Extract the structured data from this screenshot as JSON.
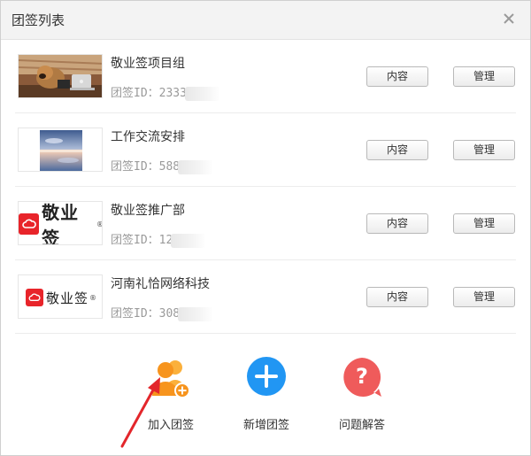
{
  "window": {
    "title": "团签列表",
    "close_icon": "close-icon"
  },
  "teams": [
    {
      "name": "敬业签项目组",
      "id_prefix": "团签ID：2333",
      "thumb": "dog-laptop-photo"
    },
    {
      "name": "工作交流安排",
      "id_prefix": "团签ID：588",
      "thumb": "sky-reflection-photo"
    },
    {
      "name": "敬业签推广部",
      "id_prefix": "团签ID：12",
      "thumb": "jingyeqian-logo",
      "logo_text": "敬业签"
    },
    {
      "name": "河南礼恰网络科技",
      "id_prefix": "团签ID：308",
      "thumb": "jingyeqian-logo",
      "logo_text": "敬业签"
    }
  ],
  "buttons": {
    "content": "内容",
    "manage": "管理"
  },
  "actions": [
    {
      "label": "加入团签",
      "icon": "join-team-icon",
      "color": "#f7941d"
    },
    {
      "label": "新增团签",
      "icon": "add-team-icon",
      "color": "#2196f3"
    },
    {
      "label": "问题解答",
      "icon": "help-icon",
      "color": "#ef5b5b"
    }
  ],
  "annotation": {
    "icon": "red-arrow-icon",
    "color": "#e3262b"
  }
}
